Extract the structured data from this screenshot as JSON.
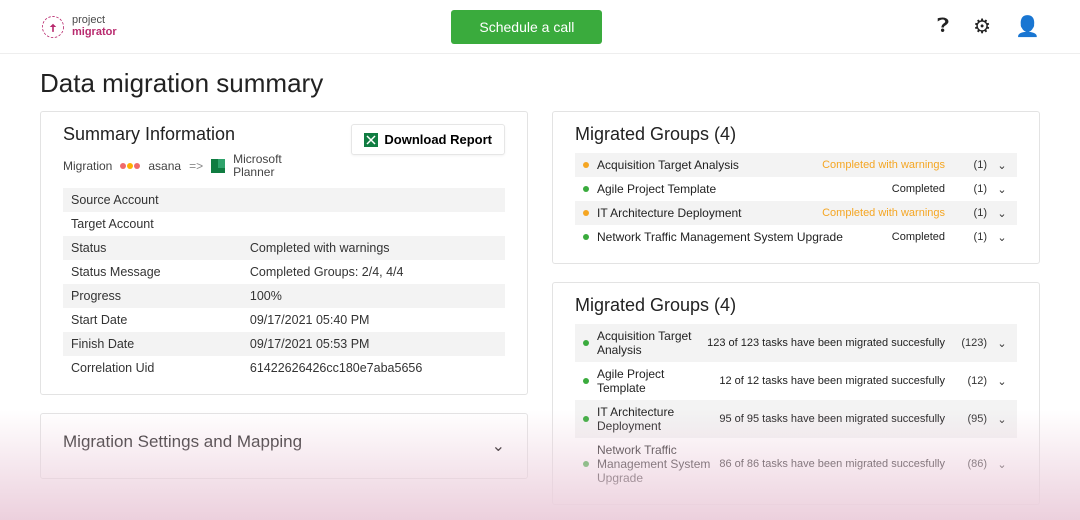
{
  "brand": {
    "name_top": "project",
    "name_bottom": "migrator"
  },
  "cta_label": "Schedule a call",
  "page_title": "Data migration summary",
  "summary": {
    "heading": "Summary Information",
    "download_label": "Download Report",
    "migration_label": "Migration",
    "source_tool": "asana",
    "arrow": "=>",
    "target_tool": "Microsoft Planner",
    "rows": [
      {
        "k": "Source Account",
        "v": ""
      },
      {
        "k": "Target Account",
        "v": ""
      },
      {
        "k": "Status",
        "v": "Completed with warnings"
      },
      {
        "k": "Status Message",
        "v": "Completed Groups: 2/4, 4/4"
      },
      {
        "k": "Progress",
        "v": "100%"
      },
      {
        "k": "Start Date",
        "v": "09/17/2021 05:40 PM"
      },
      {
        "k": "Finish Date",
        "v": "09/17/2021 05:53 PM"
      },
      {
        "k": "Correlation Uid",
        "v": "61422626426cc180e7aba5656"
      }
    ]
  },
  "settings_heading": "Migration Settings and Mapping",
  "groups_a": {
    "heading": "Migrated Groups (4)",
    "items": [
      {
        "name": "Acquisition Target Analysis",
        "status": "Completed with warnings",
        "warn": true,
        "count": "(1)"
      },
      {
        "name": "Agile Project Template",
        "status": "Completed",
        "warn": false,
        "count": "(1)"
      },
      {
        "name": "IT Architecture Deployment",
        "status": "Completed with warnings",
        "warn": true,
        "count": "(1)"
      },
      {
        "name": "Network Traffic Management System Upgrade",
        "status": "Completed",
        "warn": false,
        "count": "(1)"
      }
    ]
  },
  "groups_b": {
    "heading": "Migrated Groups (4)",
    "items": [
      {
        "name": "Acquisition Target Analysis",
        "status": "123 of 123 tasks have been migrated succesfully",
        "count": "(123)"
      },
      {
        "name": "Agile Project Template",
        "status": "12 of 12 tasks have been migrated succesfully",
        "count": "(12)"
      },
      {
        "name": "IT Architecture Deployment",
        "status": "95 of 95 tasks have been migrated succesfully",
        "count": "(95)"
      },
      {
        "name": "Network Traffic Management System Upgrade",
        "status": "86 of 86 tasks have been migrated succesfully",
        "count": "(86)"
      }
    ]
  },
  "colors": {
    "asana": [
      "#f06a6a",
      "#ffb000",
      "#f06a6a"
    ],
    "planner": "#107c41",
    "excel": "#107c41"
  }
}
